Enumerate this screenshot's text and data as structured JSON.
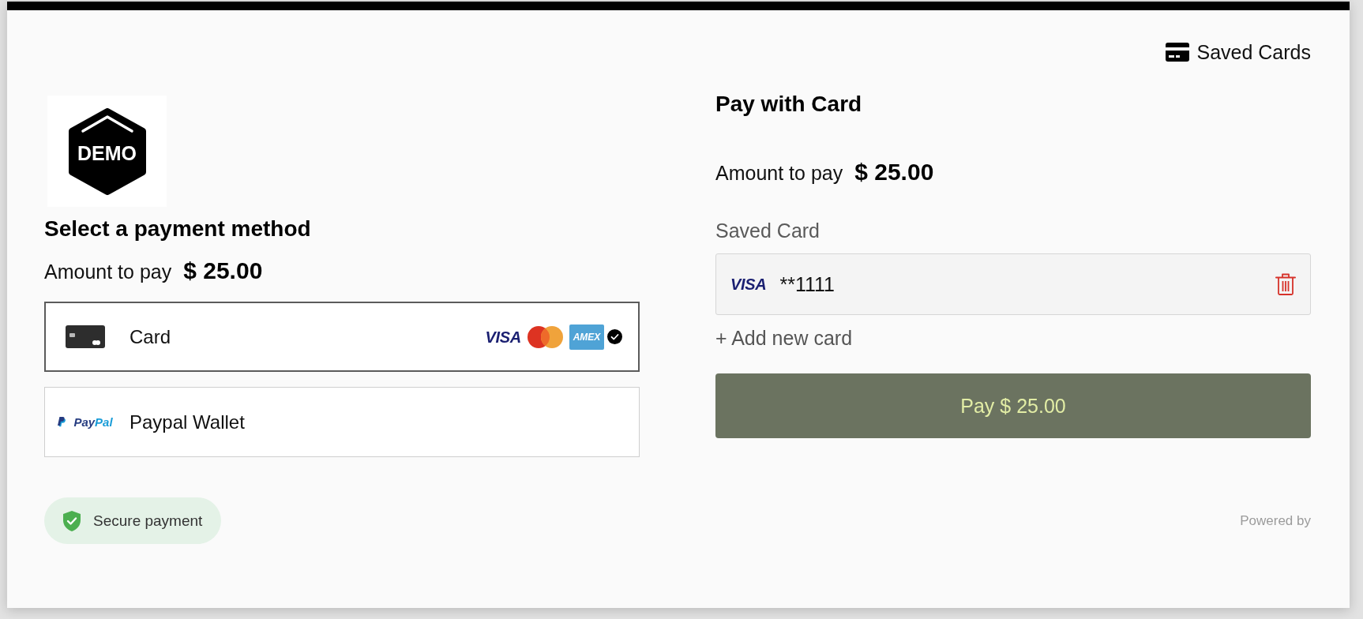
{
  "header": {
    "saved_cards_link": "Saved Cards"
  },
  "logo": {
    "text": "DEMO"
  },
  "payment_method_section": {
    "title": "Select a payment method",
    "amount_label": "Amount to pay",
    "amount": "$ 25.00",
    "options": [
      {
        "kind": "card",
        "label": "Card",
        "selected": true,
        "brands": [
          {
            "kind": "visa",
            "text": "VISA"
          },
          {
            "kind": "mastercard"
          },
          {
            "kind": "amex",
            "text": "AMEX"
          }
        ]
      },
      {
        "kind": "paypal",
        "label": "Paypal Wallet",
        "selected": false,
        "logo_text": "PayPal"
      }
    ]
  },
  "card_section": {
    "title": "Pay with Card",
    "amount_label": "Amount to pay",
    "amount": "$ 25.00",
    "saved_card_label": "Saved Card",
    "saved_card": {
      "brand": {
        "kind": "visa",
        "text": "VISA"
      },
      "number": "**1111"
    },
    "add_card_link": "+ Add new card",
    "pay_button": "Pay $ 25.00"
  },
  "footer": {
    "secure_badge": "Secure payment",
    "powered_by": "Powered by"
  }
}
